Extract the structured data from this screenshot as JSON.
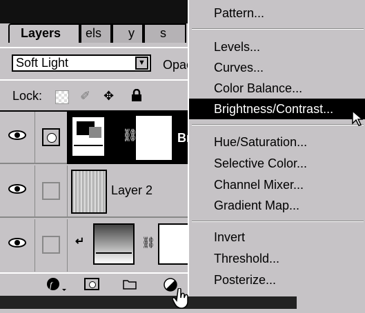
{
  "panel": {
    "tabs": [
      {
        "label": "Layers"
      },
      {
        "label": "els"
      },
      {
        "label": "y"
      },
      {
        "label": "s"
      }
    ],
    "blend_mode": "Soft Light",
    "opacity_label": "Opac",
    "lock_label": "Lock:",
    "layers": [
      {
        "name": "Br",
        "selected": true
      },
      {
        "name": "Layer 2",
        "selected": false
      },
      {
        "name": "",
        "selected": false
      }
    ]
  },
  "menu": {
    "items": [
      {
        "label": "Pattern..."
      },
      {
        "label": "Levels..."
      },
      {
        "label": "Curves..."
      },
      {
        "label": "Color Balance..."
      },
      {
        "label": "Brightness/Contrast...",
        "highlighted": true
      },
      {
        "label": "Hue/Saturation..."
      },
      {
        "label": "Selective Color..."
      },
      {
        "label": "Channel Mixer..."
      },
      {
        "label": "Gradient Map..."
      },
      {
        "label": "Invert"
      },
      {
        "label": "Threshold..."
      },
      {
        "label": "Posterize..."
      }
    ]
  },
  "icons": {
    "eye": "eye-icon",
    "lock": "lock-icon",
    "move": "move-icon",
    "brush": "brush-icon",
    "transparency": "checkerboard-icon",
    "adjustment": "adjustment-layer-icon",
    "mask": "layer-mask-icon",
    "folder": "folder-icon",
    "effects": "layer-style-icon",
    "link": "chain-link-icon",
    "clip": "clipping-arrow-icon"
  },
  "colors": {
    "panel_bg": "#c6c3c6",
    "highlight": "#000000",
    "highlight_text": "#ffffff"
  }
}
